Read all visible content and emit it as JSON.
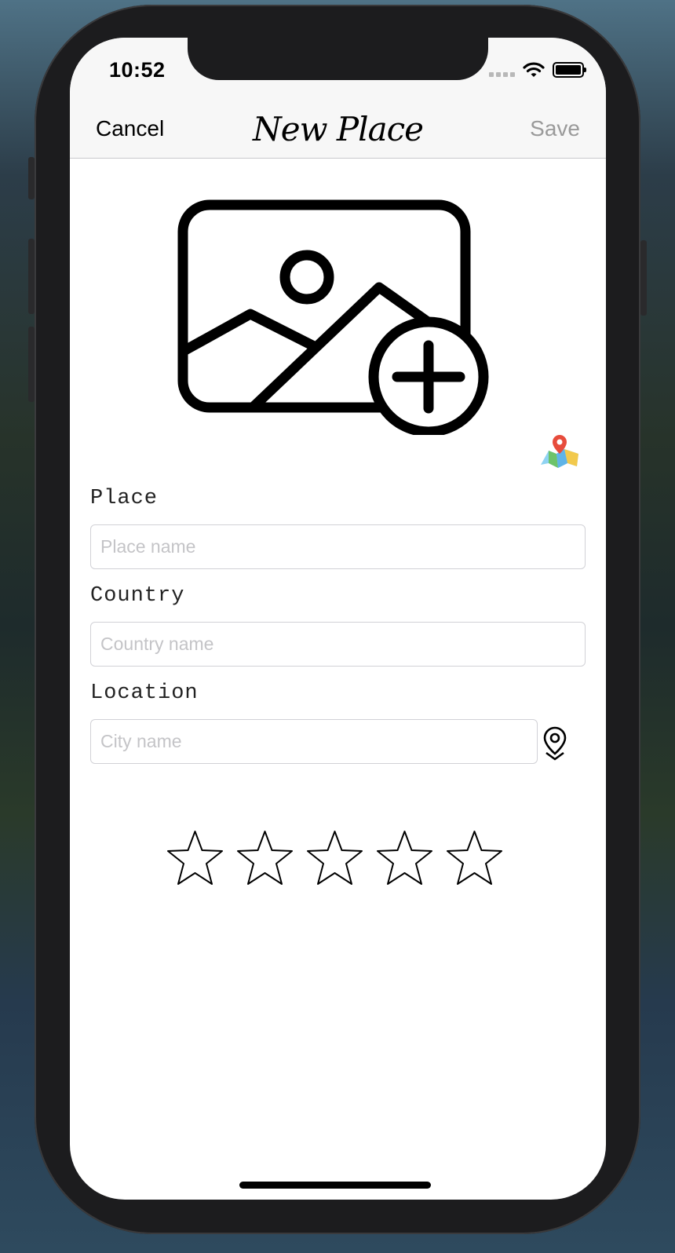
{
  "status_bar": {
    "time": "10:52",
    "signal_icon": "cellular-signal-icon",
    "wifi_icon": "wifi-icon",
    "battery_icon": "battery-icon"
  },
  "nav": {
    "cancel_label": "Cancel",
    "title": "New Place",
    "save_label": "Save",
    "save_enabled": false
  },
  "image_picker": {
    "icon": "add-photo-icon"
  },
  "map_button": {
    "icon": "map-icon"
  },
  "form": {
    "place": {
      "label": "Place",
      "value": "",
      "placeholder": "Place name"
    },
    "country": {
      "label": "Country",
      "value": "",
      "placeholder": "Country name"
    },
    "location": {
      "label": "Location",
      "value": "",
      "placeholder": "City name",
      "icon": "location-pin-icon"
    }
  },
  "rating": {
    "value": 0,
    "max": 5
  },
  "colors": {
    "nav_background": "#f7f7f7",
    "save_disabled": "#9a9a9a",
    "placeholder": "#c4c4c7",
    "input_border": "#d1d1d6"
  }
}
